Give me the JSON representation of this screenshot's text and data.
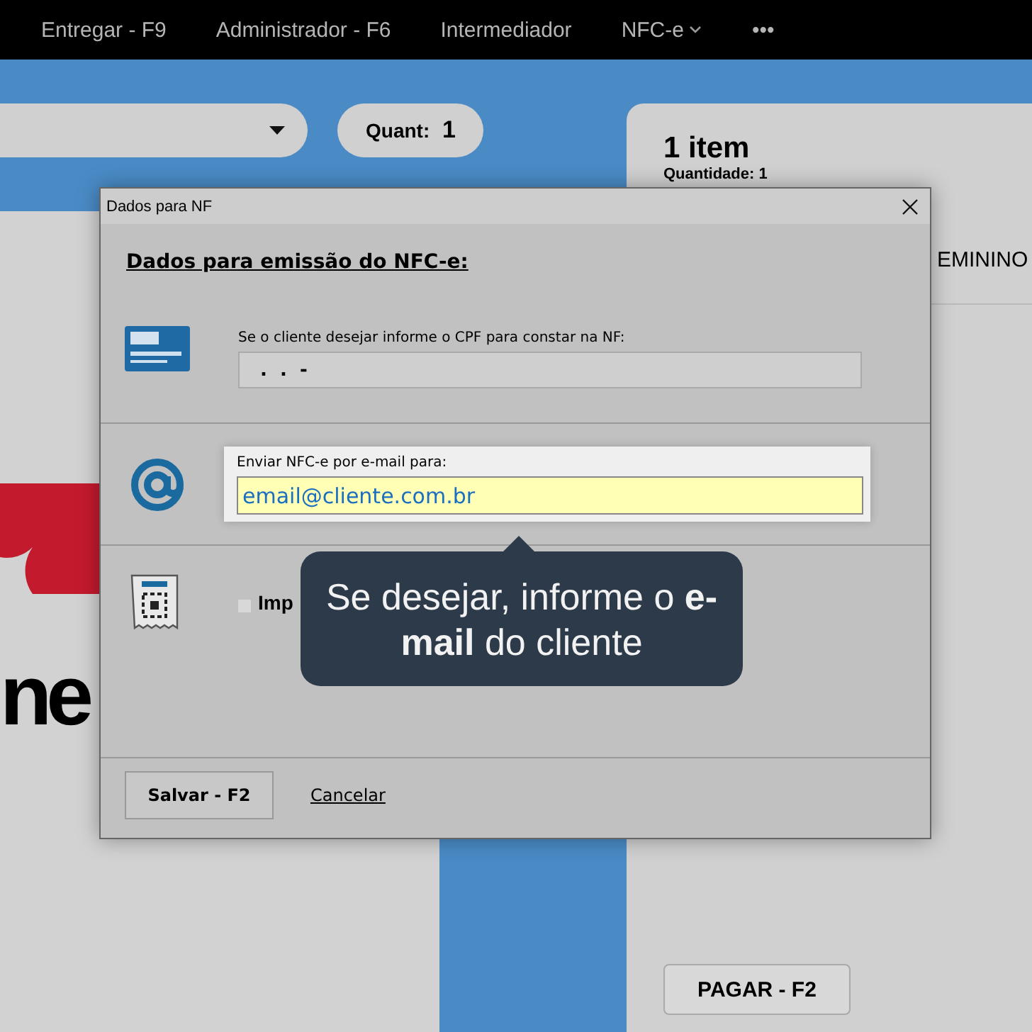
{
  "nav": {
    "items": [
      {
        "label": "Entregar - F9",
        "kind": "link"
      },
      {
        "label": "Administrador - F6",
        "kind": "link"
      },
      {
        "label": "Intermediador",
        "kind": "link"
      },
      {
        "label": "NFC-e",
        "kind": "dropdown"
      },
      {
        "label": "•••",
        "kind": "link"
      }
    ]
  },
  "sale": {
    "quantity": {
      "label": "Quant:",
      "value": "1"
    }
  },
  "logo": {
    "text": "ne"
  },
  "cart": {
    "title": "1 item",
    "quantity": "Quantidade: 1",
    "item_text": "EMININO",
    "pay_button": "PAGAR - F2"
  },
  "dialog": {
    "title": "Dados para NF",
    "heading": "Dados para emissão do NFC-e:",
    "cpf": {
      "label": "Se o cliente desejar informe o CPF para constar na NF:",
      "value": " .  .  -"
    },
    "email": {
      "label": "Enviar NFC-e por e-mail para:",
      "value": "email@cliente.com.br",
      "focused": true
    },
    "print": {
      "label": "Imp",
      "checked": false
    },
    "buttons": [
      {
        "label": "Salvar - F2",
        "kind": "button"
      },
      {
        "label": "Cancelar",
        "kind": "link"
      }
    ]
  },
  "tooltip": {
    "text": "Se desejar, informe o **e-mail** do cliente"
  }
}
